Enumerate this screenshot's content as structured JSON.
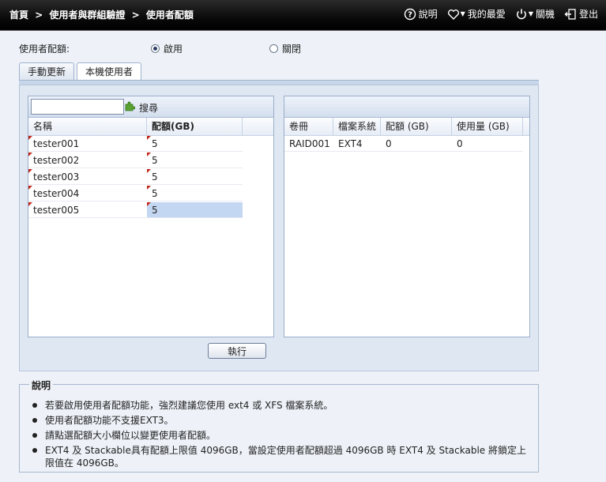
{
  "breadcrumb": {
    "home": "首頁",
    "sep": ">",
    "section": "使用者與群組驗證",
    "page": "使用者配額"
  },
  "topnav": {
    "help": "說明",
    "favorites": "我的最愛",
    "power": "關機",
    "logout": "登出"
  },
  "quota": {
    "label": "使用者配額:",
    "enable": "啟用",
    "disable": "關閉",
    "selected": "enable"
  },
  "tabs": [
    {
      "label": "手動更新"
    },
    {
      "label": "本機使用者"
    }
  ],
  "active_tab": "本機使用者",
  "left": {
    "search_placeholder": "",
    "search_label": "搜尋",
    "columns": {
      "name": "名稱",
      "quota": "配額(GB)"
    },
    "rows": [
      {
        "name": "tester001",
        "quota": "5"
      },
      {
        "name": "tester002",
        "quota": "5"
      },
      {
        "name": "tester003",
        "quota": "5"
      },
      {
        "name": "tester004",
        "quota": "5"
      },
      {
        "name": "tester005",
        "quota": "5"
      }
    ],
    "execute": "執行"
  },
  "right": {
    "columns": {
      "volume": "卷冊",
      "fs": "檔案系統",
      "quota": "配額 (GB)",
      "used": "使用量 (GB)"
    },
    "rows": [
      {
        "volume": "RAID001",
        "fs": "EXT4",
        "quota": "0",
        "used": "0"
      }
    ]
  },
  "description": {
    "title": "說明",
    "items": [
      "若要啟用使用者配額功能，強烈建議您使用 ext4 或 XFS 檔案系統。",
      "使用者配額功能不支援EXT3。",
      "請點選配額大小欄位以變更使用者配額。",
      "EXT4 及 Stackable具有配額上限值 4096GB，當設定使用者配額超過 4096GB 時 EXT4 及 Stackable 將鎖定上限值在 4096GB。"
    ]
  },
  "colors": {
    "topbar": "#000000",
    "selected_row": "#c4d7f2",
    "dirty_marker": "#c0271c",
    "panel_header": "#d3deee"
  }
}
